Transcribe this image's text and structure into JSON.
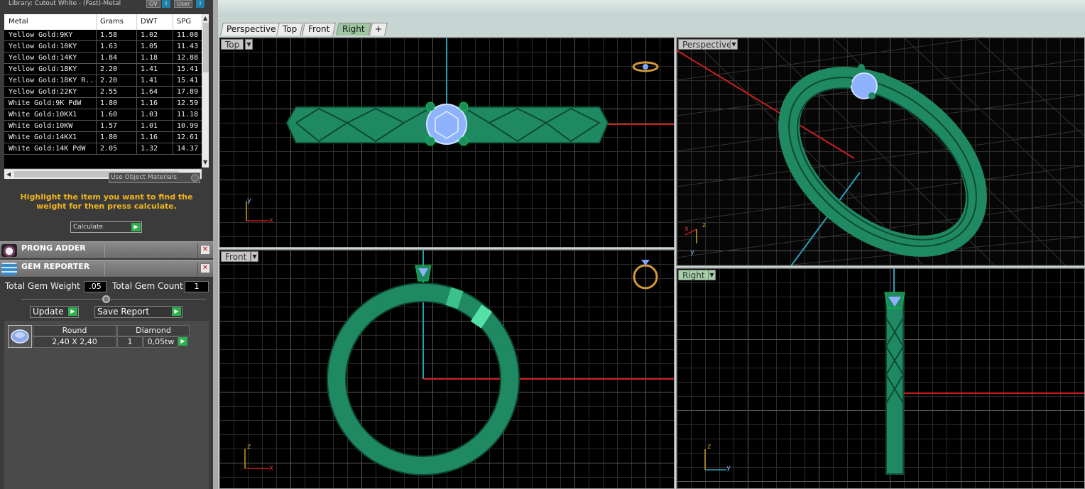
{
  "library": {
    "title": "Library: Cutout White - (Fast)-Metal",
    "tag_gv": "GV",
    "tag_user": "User"
  },
  "metal_table": {
    "columns": [
      "Metal",
      "Grams",
      "DWT",
      "SPG"
    ],
    "rows": [
      {
        "metal": "Yellow Gold:9KY",
        "grams": "1.58",
        "dwt": "1.02",
        "spg": "11.08"
      },
      {
        "metal": "Yellow Gold:10KY",
        "grams": "1.63",
        "dwt": "1.05",
        "spg": "11.43"
      },
      {
        "metal": "Yellow Gold:14KY",
        "grams": "1.84",
        "dwt": "1.18",
        "spg": "12.88"
      },
      {
        "metal": "Yellow Gold:18KY",
        "grams": "2.20",
        "dwt": "1.41",
        "spg": "15.41"
      },
      {
        "metal": "Yellow Gold:18KY R...",
        "grams": "2.20",
        "dwt": "1.41",
        "spg": "15.41"
      },
      {
        "metal": "Yellow Gold:22KY",
        "grams": "2.55",
        "dwt": "1.64",
        "spg": "17.89"
      },
      {
        "metal": "White Gold:9K PdW",
        "grams": "1.80",
        "dwt": "1.16",
        "spg": "12.59"
      },
      {
        "metal": "White Gold:10KX1",
        "grams": "1.60",
        "dwt": "1.03",
        "spg": "11.18"
      },
      {
        "metal": "White Gold:10KW",
        "grams": "1.57",
        "dwt": "1.01",
        "spg": "10.99"
      },
      {
        "metal": "White Gold:14KX1",
        "grams": "1.80",
        "dwt": "1.16",
        "spg": "12.61"
      },
      {
        "metal": "White Gold:14K PdW",
        "grams": "2.05",
        "dwt": "1.32",
        "spg": "14.37"
      }
    ]
  },
  "use_object_materials": "Use Object Materials",
  "hint_text": "Highlight the item you want to find the weight for then press calculate.",
  "calculate_label": "Calculate",
  "prong_adder": {
    "title": "PRONG ADDER"
  },
  "gem_reporter": {
    "title": "GEM REPORTER",
    "total_weight_label": "Total Gem Weight",
    "total_weight_value": ".05",
    "total_count_label": "Total Gem Count",
    "total_count_value": "1",
    "update_label": "Update",
    "save_report_label": "Save Report",
    "gem": {
      "shape": "Round",
      "material": "Diamond",
      "size": "2,40 X 2,40",
      "count": "1",
      "weight": "0,05tw"
    }
  },
  "tabs": [
    {
      "label": "Perspective",
      "active": false
    },
    {
      "label": "Top",
      "active": false
    },
    {
      "label": "Front",
      "active": false
    },
    {
      "label": "Right",
      "active": true
    }
  ],
  "tab_add": "+",
  "viewports": {
    "top": "Top",
    "perspective": "Perspective",
    "front": "Front",
    "right": "Right"
  },
  "axis": {
    "x": "x",
    "y": "y",
    "z": "z"
  },
  "colors": {
    "ring_green": "#1f8a62",
    "ring_dark": "#0f5c40",
    "gem_blue": "#8fb2ff",
    "axis_red": "#c81e1e",
    "axis_cyan": "#2aa0b8",
    "hint_orange": "#f0b51e",
    "go_green": "#2bb24c"
  }
}
